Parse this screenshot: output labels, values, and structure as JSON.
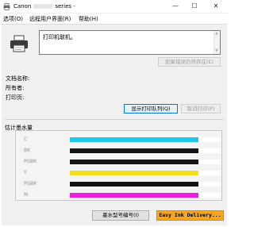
{
  "window": {
    "title_prefix": "Canon",
    "title_suffix": "series -",
    "minimize": "—",
    "maximize": "☐",
    "close": "✕"
  },
  "menu": {
    "items": [
      {
        "label": "选项(O)"
      },
      {
        "label": "远程用户界面(R)"
      },
      {
        "label": "帮助(H)"
      }
    ]
  },
  "status": {
    "message": "打印机联机。",
    "cancel_error_button": "如果错误仍然存在(E)"
  },
  "job": {
    "doc_name_label": "文档名称:",
    "owner_label": "所有者:",
    "printing_label": "打印页:",
    "show_queue_button": "显示打印队列(Q)",
    "cancel_print_button": "取消打印(P)"
  },
  "ink": {
    "section_title": "估计墨水量",
    "cartridges": [
      {
        "name": "C",
        "color": "#1ec8e6",
        "level": 0.85
      },
      {
        "name": "BK",
        "color": "#141414",
        "level": 0.85
      },
      {
        "name": "PGBK",
        "color": "#141414",
        "level": 0.85
      },
      {
        "name": "Y",
        "color": "#f2de1a",
        "level": 0.85
      },
      {
        "name": "PGBK",
        "color": "#141414",
        "level": 0.85
      },
      {
        "name": "M",
        "color": "#ee1ee0",
        "level": 0.85
      }
    ]
  },
  "footer": {
    "model_button": "墨水型号编号(I)",
    "delivery_button": "Easy Ink Delivery..."
  },
  "colors": {
    "accent": "#0078d7",
    "delivery": "#f5a623"
  }
}
